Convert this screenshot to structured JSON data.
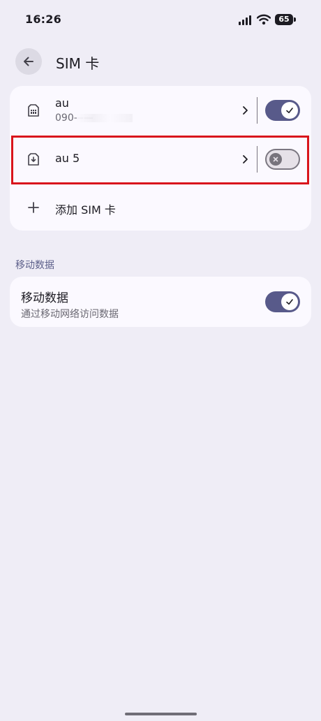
{
  "status_bar": {
    "time": "16:26",
    "battery": "65"
  },
  "header": {
    "title": "SIM 卡"
  },
  "sims": [
    {
      "name": "au",
      "number": "090——",
      "enabled": true
    },
    {
      "name": "au 5",
      "enabled": false
    }
  ],
  "add_sim": {
    "label": "添加 SIM 卡"
  },
  "mobile_data": {
    "section_label": "移动数据",
    "title": "移动数据",
    "subtitle": "通过移动网络访问数据",
    "enabled": true
  },
  "colors": {
    "accent": "#585a8a",
    "highlight": "#d9151c",
    "background": "#efedf6",
    "card": "#fbf9ff"
  }
}
